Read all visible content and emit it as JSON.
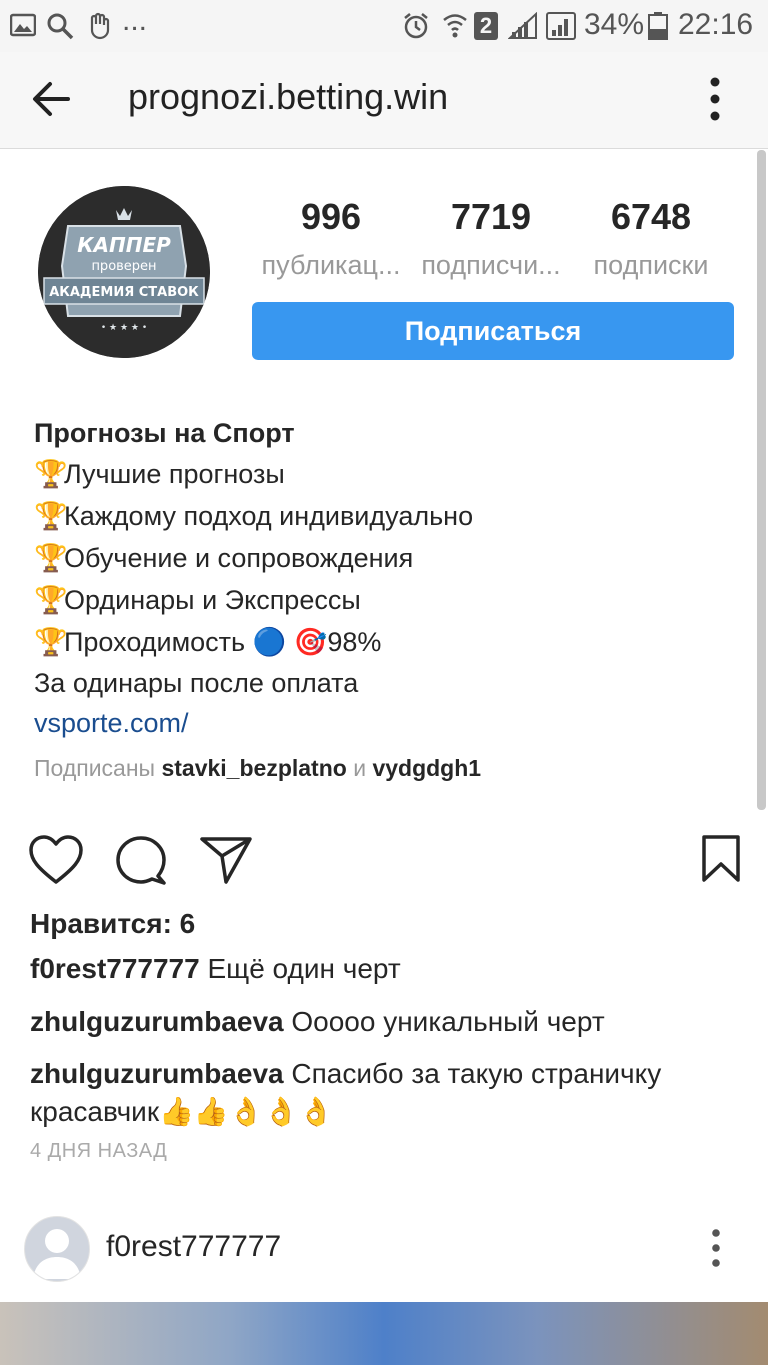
{
  "status_bar": {
    "notification_dots": "...",
    "sim_badge": "2",
    "battery_percent": "34%",
    "time": "22:16"
  },
  "app_bar": {
    "title": "prognozi.betting.win"
  },
  "profile": {
    "avatar_text": {
      "line1": "КАППЕР",
      "line2": "проверен",
      "line3": "АКАДЕМИЯ СТАВОК",
      "stars": "• ★ ★ ★ •"
    },
    "stats": [
      {
        "value": "996",
        "label": "публикац..."
      },
      {
        "value": "7719",
        "label": "подписчи..."
      },
      {
        "value": "6748",
        "label": "подписки"
      }
    ],
    "follow_button": "Подписаться",
    "bio": {
      "name": "Прогнозы на Спорт",
      "trophy": "🏆",
      "lines": [
        "Лучшие прогнозы",
        "Каждому подход индивидуально",
        "Обучение и сопровождения",
        "Ординары и Экспрессы",
        "Проходимость 🔵 🎯98%"
      ],
      "extra_line": "За одинары после оплата",
      "link": "vsporte.com/"
    },
    "followed_by": {
      "prefix": "Подписаны",
      "user1": "stavki_bezplatno",
      "conj": "и",
      "user2": "vydgdgh1"
    }
  },
  "post": {
    "likes": "Нравится: 6",
    "comments": [
      {
        "user": "f0rest777777",
        "text": "Ещё один черт"
      },
      {
        "user": "zhulguzurumbaeva",
        "text": "Ооооо уникальный черт"
      },
      {
        "user": "zhulguzurumbaeva",
        "text": "Спасибо за такую страничку красавчик👍👍👌👌👌"
      }
    ],
    "time_ago": "4 ДНЯ НАЗАД"
  },
  "next_post": {
    "username": "f0rest777777"
  },
  "colors": {
    "accent": "#3897f0",
    "link": "#1a4d8f",
    "muted": "#999999"
  },
  "icons": [
    "gallery-icon",
    "search-icon",
    "hand-icon",
    "alarm-icon",
    "wifi-icon",
    "signal-icon",
    "battery-icon",
    "back-arrow-icon",
    "more-vertical-icon",
    "heart-icon",
    "comment-icon",
    "share-icon",
    "bookmark-icon"
  ]
}
